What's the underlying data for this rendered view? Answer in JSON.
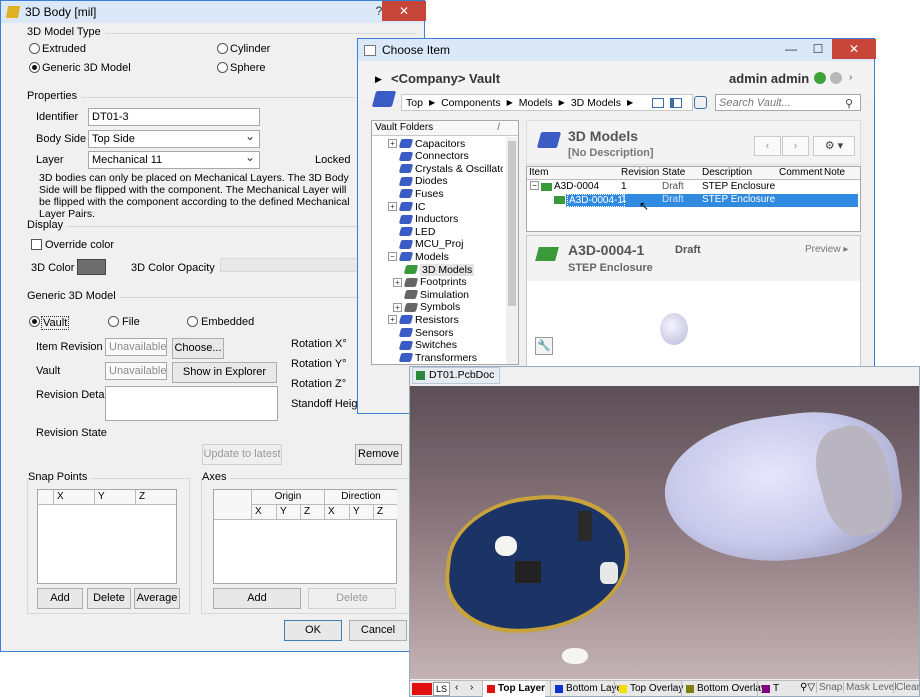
{
  "body_dialog": {
    "title": "3D Body [mil]",
    "help": "?",
    "model_type": {
      "title": "3D Model Type",
      "extruded": "Extruded",
      "cylinder": "Cylinder",
      "generic": "Generic 3D Model",
      "sphere": "Sphere"
    },
    "properties": {
      "title": "Properties",
      "identifier_label": "Identifier",
      "identifier_value": "DT01-3",
      "body_side_label": "Body Side",
      "body_side_value": "Top Side",
      "layer_label": "Layer",
      "layer_value": "Mechanical 11",
      "locked_label": "Locked",
      "note": "3D bodies can only be placed on Mechanical Layers. The 3D Body Side will be flipped with the component. The Mechanical Layer will be flipped with the component according to the defined Mechanical Layer Pairs."
    },
    "display": {
      "title": "Display",
      "override_color": "Override color",
      "color_label": "3D Color",
      "color_value": "#6e6e6e",
      "opacity_label": "3D Color Opacity"
    },
    "generic": {
      "title": "Generic 3D Model",
      "vault": "Vault",
      "file": "File",
      "embedded": "Embedded",
      "item_revision_label": "Item Revision",
      "item_revision_placeholder": "Unavailable",
      "choose": "Choose...",
      "vault_label": "Vault",
      "vault_placeholder": "Unavailable",
      "show_explorer": "Show in Explorer",
      "revision_details": "Revision Details",
      "revision_state": "Revision State",
      "update": "Update to latest",
      "remove": "Remove",
      "rotation_x": "Rotation X°",
      "rotation_y": "Rotation Y°",
      "rotation_z": "Rotation Z°",
      "standoff": "Standoff Height"
    },
    "snap": {
      "title": "Snap Points",
      "cols": [
        "X",
        "Y",
        "Z"
      ],
      "add": "Add",
      "delete": "Delete",
      "average": "Average"
    },
    "axes": {
      "title": "Axes",
      "origin": "Origin",
      "direction": "Direction",
      "cols": [
        "X",
        "Y",
        "Z",
        "X",
        "Y",
        "Z"
      ],
      "add": "Add",
      "delete": "Delete"
    },
    "ok": "OK",
    "cancel": "Cancel"
  },
  "choose_item": {
    "title": "Choose Item",
    "vault_title": "<Company> Vault",
    "user": "admin admin",
    "breadcrumb": [
      "Top",
      "Components",
      "Models",
      "3D Models"
    ],
    "search_placeholder": "Search Vault...",
    "folders_title": "Vault Folders",
    "folders": [
      {
        "label": "Capacitors",
        "indent": 0,
        "exp": "+"
      },
      {
        "label": "Connectors",
        "indent": 0,
        "exp": ""
      },
      {
        "label": "Crystals & Oscillators",
        "indent": 0,
        "exp": ""
      },
      {
        "label": "Diodes",
        "indent": 0,
        "exp": ""
      },
      {
        "label": "Fuses",
        "indent": 0,
        "exp": ""
      },
      {
        "label": "IC",
        "indent": 0,
        "exp": "+"
      },
      {
        "label": "Inductors",
        "indent": 0,
        "exp": ""
      },
      {
        "label": "LED",
        "indent": 0,
        "exp": ""
      },
      {
        "label": "MCU_Proj",
        "indent": 0,
        "exp": ""
      },
      {
        "label": "Models",
        "indent": 0,
        "exp": "−"
      },
      {
        "label": "3D Models",
        "indent": 1,
        "exp": "",
        "selected": true
      },
      {
        "label": "Footprints",
        "indent": 1,
        "exp": "+"
      },
      {
        "label": "Simulation",
        "indent": 1,
        "exp": ""
      },
      {
        "label": "Symbols",
        "indent": 1,
        "exp": "+"
      },
      {
        "label": "Resistors",
        "indent": 0,
        "exp": "+"
      },
      {
        "label": "Sensors",
        "indent": 0,
        "exp": ""
      },
      {
        "label": "Switches",
        "indent": 0,
        "exp": ""
      },
      {
        "label": "Transformers",
        "indent": 0,
        "exp": ""
      }
    ],
    "folder_name": "3D Models",
    "folder_desc": "[No Description]",
    "columns": [
      "Item",
      "Revision",
      "State",
      "Description",
      "Comment",
      "Note"
    ],
    "rows": [
      {
        "item": "A3D-0004",
        "revision": "1",
        "state": "Draft",
        "description": "STEP Enclosure",
        "exp": "−"
      },
      {
        "item": "A3D-0004-1",
        "revision": "1",
        "state": "Draft",
        "description": "STEP Enclosure",
        "selected": true
      }
    ],
    "detail_name": "A3D-0004-1",
    "detail_state": "Draft",
    "detail_desc": "STEP Enclosure",
    "preview": "Preview"
  },
  "pcb": {
    "tab": "DT01.PcbDoc *",
    "ls": "LS",
    "layers": [
      {
        "name": "Top Layer",
        "color": "#e01010",
        "active": true
      },
      {
        "name": "Bottom Layer",
        "color": "#1030d0"
      },
      {
        "name": "Top Overlay",
        "color": "#f2e000"
      },
      {
        "name": "Bottom Overlay",
        "color": "#808010"
      },
      {
        "name": "T",
        "color": "#800080"
      }
    ],
    "snap": "Snap",
    "mask": "Mask Level",
    "clear": "Clear"
  }
}
